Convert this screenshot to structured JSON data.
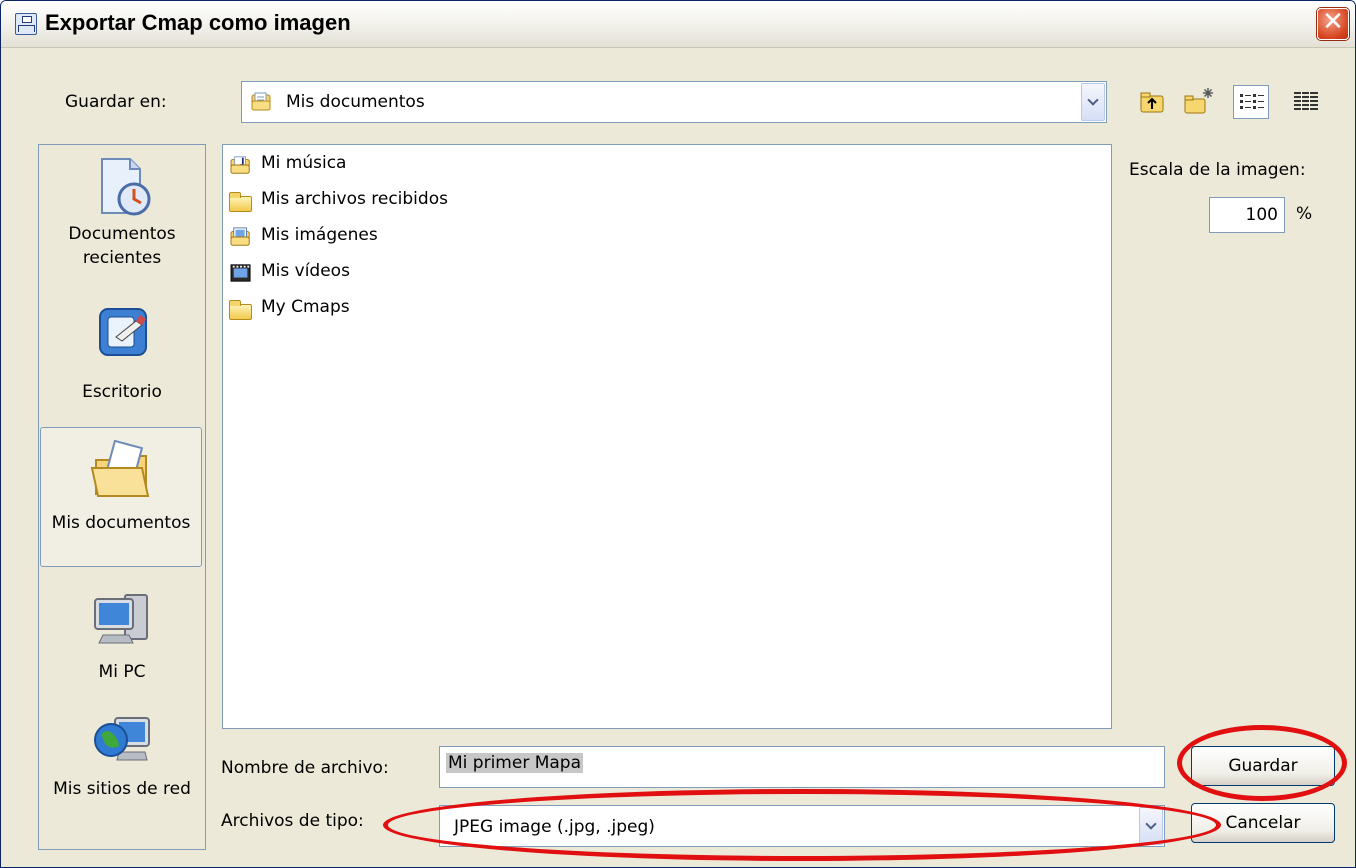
{
  "window": {
    "title": "Exportar Cmap como imagen",
    "close_symbol": "✕"
  },
  "save_in": {
    "label": "Guardar en:",
    "value": "Mis documentos",
    "icon": "documents-folder-icon"
  },
  "toolbar": {
    "buttons": [
      {
        "name": "up-one-level",
        "icon": "folder-up-icon"
      },
      {
        "name": "create-new-folder",
        "icon": "new-folder-icon"
      },
      {
        "name": "list-view",
        "icon": "list-view-icon",
        "active": true
      },
      {
        "name": "details-view",
        "icon": "details-view-icon"
      }
    ]
  },
  "places": [
    {
      "label_line1": "Documentos",
      "label_line2": "recientes",
      "icon": "recent-documents-icon"
    },
    {
      "label_line1": "Escritorio",
      "label_line2": "",
      "icon": "desktop-icon"
    },
    {
      "label_line1": "Mis documentos",
      "label_line2": "",
      "icon": "my-documents-icon",
      "selected": true
    },
    {
      "label_line1": "Mi PC",
      "label_line2": "",
      "icon": "my-computer-icon"
    },
    {
      "label_line1": "Mis sitios de red",
      "label_line2": "",
      "icon": "network-places-icon"
    }
  ],
  "files": [
    {
      "name": "Mi música",
      "icon": "music-folder-icon"
    },
    {
      "name": "Mis archivos recibidos",
      "icon": "folder-icon"
    },
    {
      "name": "Mis imágenes",
      "icon": "pictures-folder-icon"
    },
    {
      "name": "Mis vídeos",
      "icon": "videos-folder-icon"
    },
    {
      "name": "My Cmaps",
      "icon": "folder-icon"
    }
  ],
  "scale": {
    "label": "Escala de la imagen:",
    "value": "100",
    "unit": "%"
  },
  "filename": {
    "label": "Nombre de archivo:",
    "value": "Mi primer Mapa"
  },
  "filetype": {
    "label": "Archivos de tipo:",
    "value": "JPEG image (.jpg, .jpeg)"
  },
  "buttons": {
    "save": "Guardar",
    "cancel": "Cancelar"
  },
  "colors": {
    "annotation": "#e10f0f",
    "dialog_bg": "#ece9d8",
    "border": "#7f9db9"
  }
}
